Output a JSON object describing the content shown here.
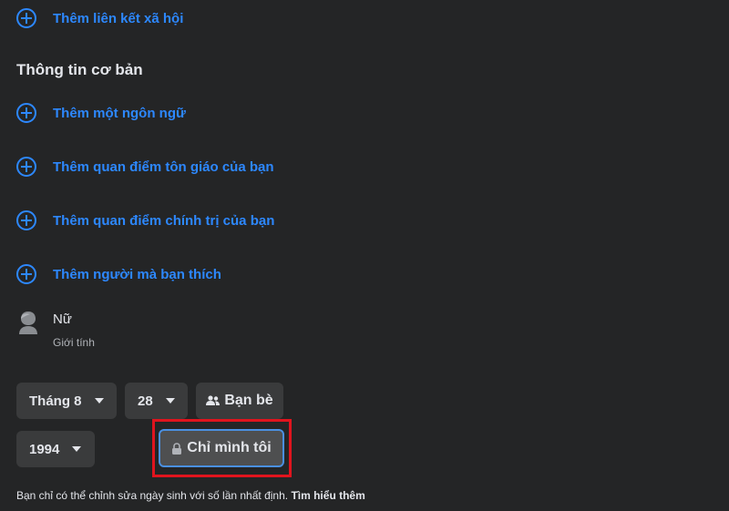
{
  "links": {
    "social": "Thêm liên kết xã hội"
  },
  "basic_info": {
    "title": "Thông tin cơ bản",
    "add_items": [
      "Thêm một ngôn ngữ",
      "Thêm quan điểm tôn giáo của bạn",
      "Thêm quan điểm chính trị của bạn",
      "Thêm người mà bạn thích"
    ],
    "gender": {
      "value": "Nữ",
      "label": "Giới tính"
    }
  },
  "birthday": {
    "month": "Tháng 8",
    "day": "28",
    "year": "1994",
    "audience_day": "Bạn bè",
    "audience_year": "Chỉ mình tôi",
    "note": "Bạn chỉ có thể chỉnh sửa ngày sinh với số lần nhất định.",
    "learn_more": "Tìm hiểu thêm"
  },
  "colors": {
    "background": "#242526",
    "link_blue": "#2d88ff",
    "button_bg": "#3a3b3c",
    "highlight_red": "#e0141e"
  },
  "icons": [
    "plus-circle-icon",
    "gender-icon",
    "caret-down-icon",
    "friends-icon",
    "lock-icon"
  ]
}
